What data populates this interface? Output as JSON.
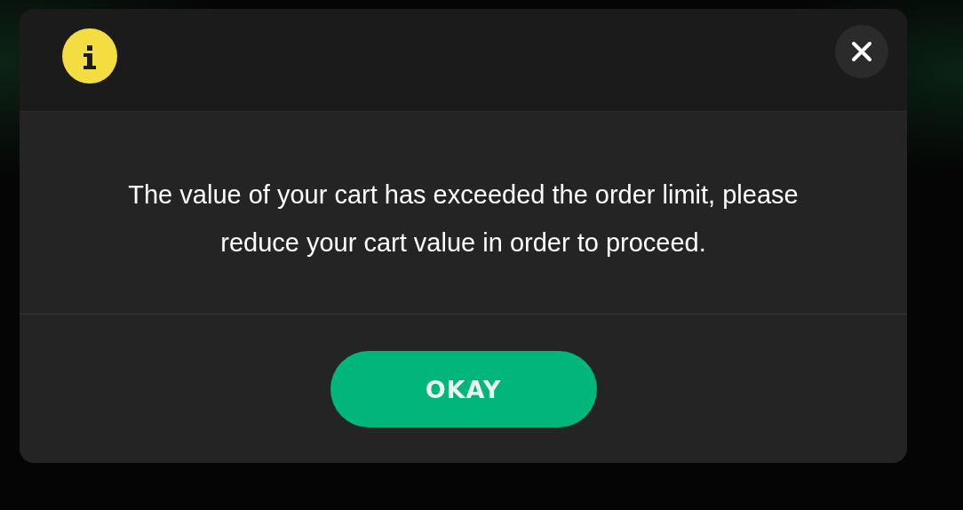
{
  "dialog": {
    "message": "The value of your cart has exceeded the order limit, please reduce your cart value in order to proceed.",
    "button": "OKAY"
  }
}
